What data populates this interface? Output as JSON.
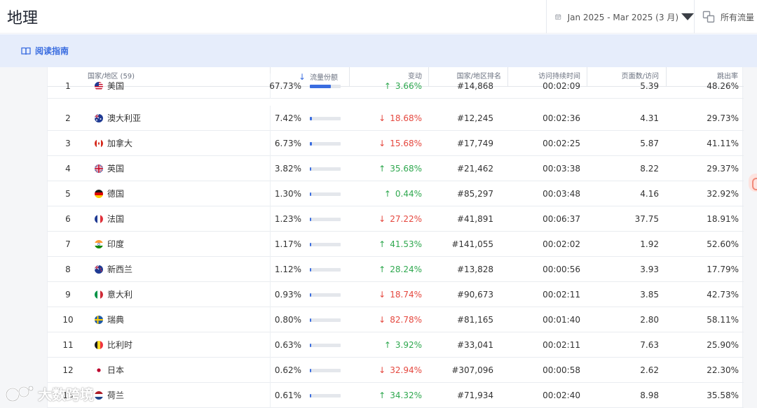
{
  "header": {
    "title": "地理",
    "date_range": "Jan 2025 - Mar 2025 (3 月)",
    "traffic_filter": "所有流量"
  },
  "guide": {
    "label": "阅读指南"
  },
  "table": {
    "columns": {
      "country": "国家/地区 (59)",
      "share": "流量份额",
      "change": "变动",
      "rank": "国家/地区排名",
      "duration": "访问持续时间",
      "pages": "页面数/访问",
      "bounce": "跳出率"
    },
    "rows": [
      {
        "n": "1",
        "flag": "us",
        "country": "美国",
        "share": "67.73%",
        "share_frac": 0.6773,
        "dir": "up",
        "change": "3.66%",
        "rank": "#14,868",
        "duration": "00:02:09",
        "pages": "5.39",
        "bounce": "48.26%"
      },
      {
        "n": "2",
        "flag": "au",
        "country": "澳大利亚",
        "share": "7.42%",
        "share_frac": 0.0742,
        "dir": "down",
        "change": "18.68%",
        "rank": "#12,245",
        "duration": "00:02:36",
        "pages": "4.31",
        "bounce": "29.73%"
      },
      {
        "n": "3",
        "flag": "ca",
        "country": "加拿大",
        "share": "6.73%",
        "share_frac": 0.0673,
        "dir": "down",
        "change": "15.68%",
        "rank": "#17,749",
        "duration": "00:02:25",
        "pages": "5.87",
        "bounce": "41.11%"
      },
      {
        "n": "4",
        "flag": "gb",
        "country": "英国",
        "share": "3.82%",
        "share_frac": 0.0382,
        "dir": "up",
        "change": "35.68%",
        "rank": "#21,462",
        "duration": "00:03:38",
        "pages": "8.22",
        "bounce": "29.37%"
      },
      {
        "n": "5",
        "flag": "de",
        "country": "德国",
        "share": "1.30%",
        "share_frac": 0.013,
        "dir": "up",
        "change": "0.44%",
        "rank": "#85,297",
        "duration": "00:03:48",
        "pages": "4.16",
        "bounce": "32.92%"
      },
      {
        "n": "6",
        "flag": "fr",
        "country": "法国",
        "share": "1.23%",
        "share_frac": 0.0123,
        "dir": "down",
        "change": "27.22%",
        "rank": "#41,891",
        "duration": "00:06:37",
        "pages": "37.75",
        "bounce": "18.91%"
      },
      {
        "n": "7",
        "flag": "in",
        "country": "印度",
        "share": "1.17%",
        "share_frac": 0.0117,
        "dir": "up",
        "change": "41.53%",
        "rank": "#141,055",
        "duration": "00:02:02",
        "pages": "1.92",
        "bounce": "52.60%"
      },
      {
        "n": "8",
        "flag": "nz",
        "country": "新西兰",
        "share": "1.12%",
        "share_frac": 0.0112,
        "dir": "up",
        "change": "28.24%",
        "rank": "#13,828",
        "duration": "00:00:56",
        "pages": "3.93",
        "bounce": "17.79%"
      },
      {
        "n": "9",
        "flag": "it",
        "country": "意大利",
        "share": "0.93%",
        "share_frac": 0.0093,
        "dir": "down",
        "change": "18.74%",
        "rank": "#90,673",
        "duration": "00:02:11",
        "pages": "3.85",
        "bounce": "42.73%"
      },
      {
        "n": "10",
        "flag": "se",
        "country": "瑞典",
        "share": "0.80%",
        "share_frac": 0.008,
        "dir": "down",
        "change": "82.78%",
        "rank": "#81,165",
        "duration": "00:01:40",
        "pages": "2.80",
        "bounce": "58.11%"
      },
      {
        "n": "11",
        "flag": "be",
        "country": "比利时",
        "share": "0.63%",
        "share_frac": 0.0063,
        "dir": "up",
        "change": "3.92%",
        "rank": "#33,041",
        "duration": "00:02:11",
        "pages": "7.63",
        "bounce": "25.90%"
      },
      {
        "n": "12",
        "flag": "jp",
        "country": "日本",
        "share": "0.62%",
        "share_frac": 0.0062,
        "dir": "down",
        "change": "32.94%",
        "rank": "#307,096",
        "duration": "00:00:58",
        "pages": "2.62",
        "bounce": "22.30%"
      },
      {
        "n": "13",
        "flag": "nl",
        "country": "荷兰",
        "share": "0.61%",
        "share_frac": 0.0061,
        "dir": "up",
        "change": "34.32%",
        "rank": "#71,934",
        "duration": "00:02:40",
        "pages": "8.98",
        "bounce": "35.58%"
      }
    ]
  },
  "watermark": {
    "text": "大数跨境"
  },
  "colors": {
    "accent": "#3a6de0",
    "up": "#2fa84f",
    "down": "#e5483f",
    "banner": "#e6edfb"
  }
}
